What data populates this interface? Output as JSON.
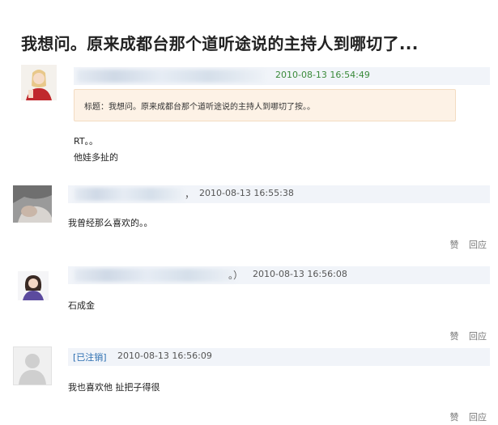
{
  "thread": {
    "title": "我想问。原来成都台那个道听途说的主持人到哪切了..."
  },
  "posts": [
    {
      "time": "2010-08-13 16:54:49",
      "quote": "标题：我想问。原来成都台那个道听途说的主持人到哪切了按。。",
      "lines": [
        "RT。。",
        "他娃多扯的"
      ]
    },
    {
      "time": "2010-08-13 16:55:38",
      "separator": "，",
      "text": "我曾经那么喜欢的。。",
      "like": "赞",
      "reply": "回应"
    },
    {
      "time": "2010-08-13 16:56:08",
      "separator": "。）",
      "text": "石成金",
      "like": "赞",
      "reply": "回应"
    },
    {
      "author": "[已注销]",
      "time": "2010-08-13 16:56:09",
      "text": "我也喜欢他 扯把子得很",
      "like": "赞",
      "reply": "回应"
    }
  ]
}
